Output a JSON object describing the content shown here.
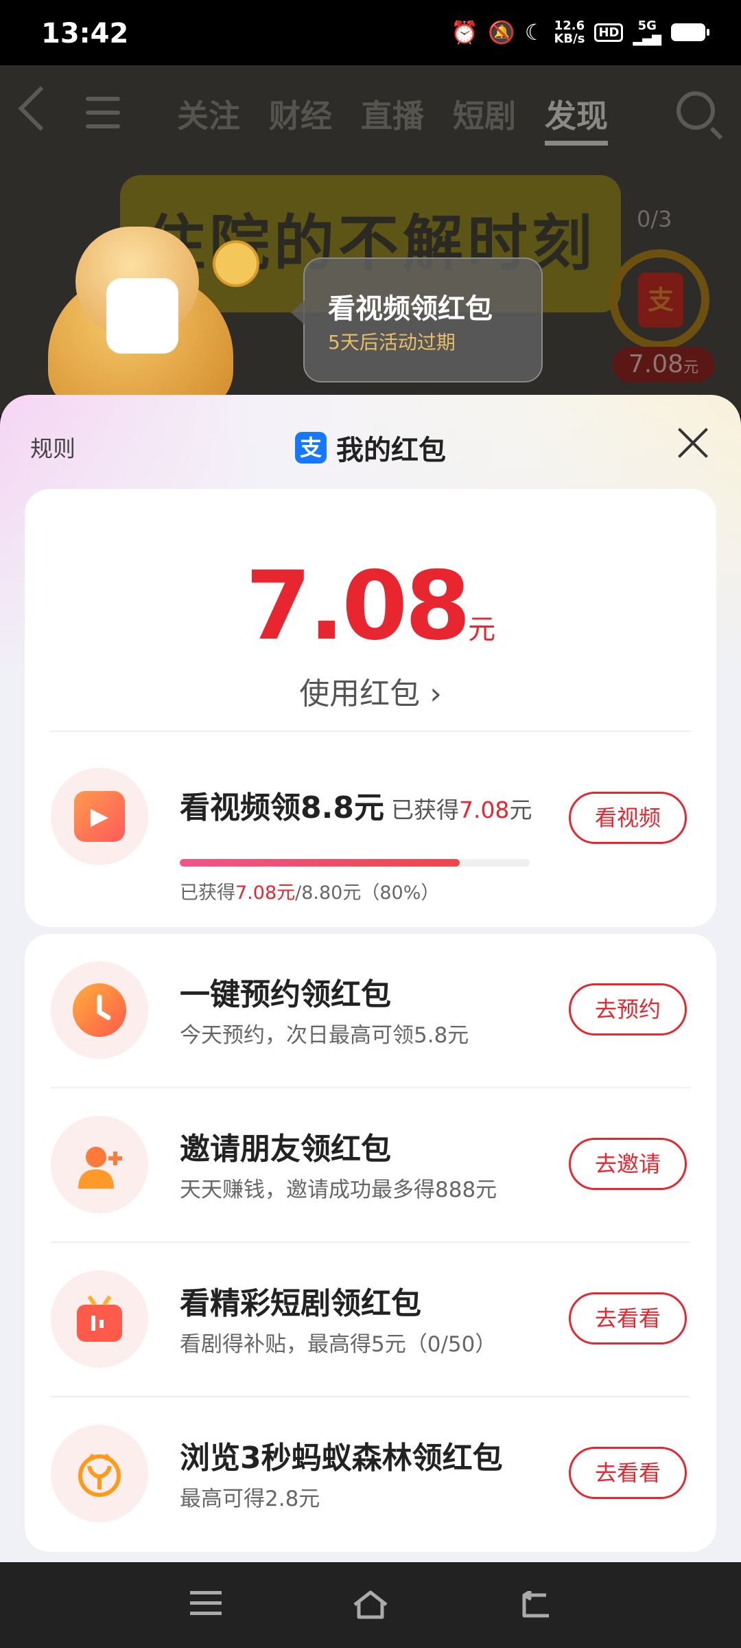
{
  "status_bar": {
    "time": "13:42",
    "speed_top": "12.6",
    "speed_bottom": "KB/s",
    "hd": "HD",
    "net": "5G"
  },
  "background": {
    "nav_tabs": [
      "关注",
      "财经",
      "直播",
      "短剧",
      "发现"
    ],
    "active_tab": "发现",
    "video_banner_text": "住院的不解时刻",
    "bubble_title": "看视频领红包",
    "bubble_sub": "5天后活动过期",
    "counter": "0/3",
    "envelope_char": "支",
    "amount": "7.08",
    "amount_unit": "元"
  },
  "sheet": {
    "rules": "规则",
    "title": "我的红包",
    "alipay_char": "支",
    "balance": "7.08",
    "balance_unit": "元",
    "use_label": "使用红包",
    "use_chevron": "›"
  },
  "video_task": {
    "title": "看视频领8.8元",
    "got_label": "已获得",
    "got_amount": "7.08",
    "got_unit": "元",
    "sub_prefix": "已获得",
    "sub_amount": "7.08元",
    "sub_suffix": "/8.80元（80%）",
    "progress": 0.8,
    "button": "看视频"
  },
  "tasks": [
    {
      "title": "一键预约领红包",
      "sub": "今天预约，次日最高可领5.8元",
      "button": "去预约",
      "icon": "clock-icon"
    },
    {
      "title": "邀请朋友领红包",
      "sub": "天天赚钱，邀请成功最多得888元",
      "button": "去邀请",
      "icon": "add-person-icon"
    },
    {
      "title": "看精彩短剧领红包",
      "sub": "看剧得补贴，最高得5元（0/50）",
      "button": "去看看",
      "icon": "tv-icon"
    },
    {
      "title": "浏览3秒蚂蚁森林领红包",
      "sub": "最高可得2.8元",
      "button": "去看看",
      "icon": "sprout-icon"
    }
  ],
  "colors": {
    "accent": "#e8262f",
    "alipay": "#1677ff"
  }
}
